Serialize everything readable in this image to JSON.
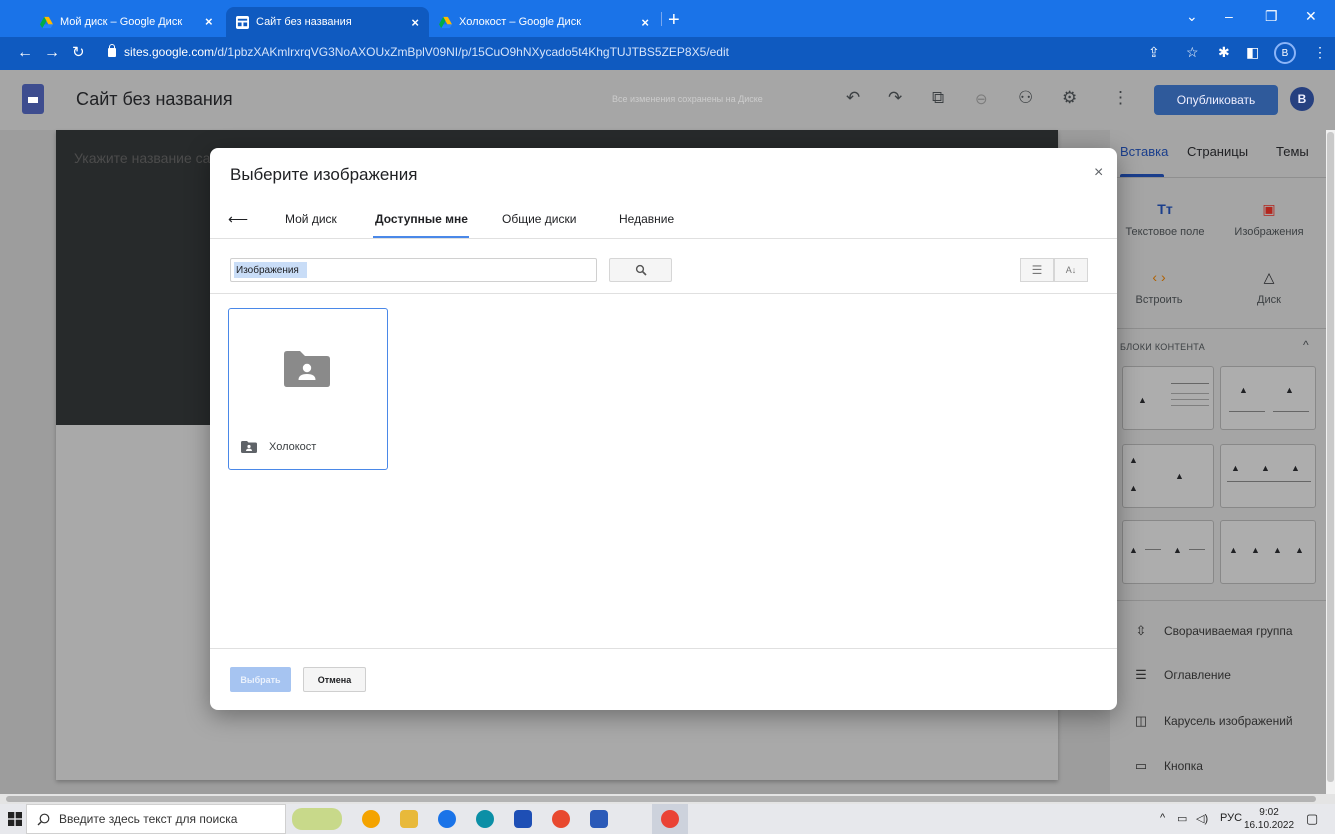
{
  "browser": {
    "tabs": [
      {
        "label": "Мой диск – Google Диск",
        "active": false
      },
      {
        "label": "Сайт без названия",
        "active": true
      },
      {
        "label": "Холокост – Google Диск",
        "active": false
      }
    ],
    "address_host": "sites.google.com",
    "address_path": "/d/1pbzXAKmlrxrqVG3NoAXOUxZmBplV09NI/p/15CuO9hNXycado5t4KhgTUJTBS5ZEP8X5/edit",
    "profile_initial": "В"
  },
  "sites_header": {
    "title": "Сайт без названия",
    "save_status": "Все изменения сохранены на Диске",
    "publish_label": "Опубликовать",
    "avatar_initial": "В"
  },
  "page_canvas": {
    "title_placeholder": "Укажите название сайта"
  },
  "dialog": {
    "title": "Выберите изображения",
    "tabs": [
      {
        "label": "Мой диск",
        "active": false
      },
      {
        "label": "Доступные мне",
        "active": true
      },
      {
        "label": "Общие диски",
        "active": false
      },
      {
        "label": "Недавние",
        "active": false
      }
    ],
    "search_value": "Изображения",
    "folders": [
      {
        "name": "Холокост"
      }
    ],
    "select_label": "Выбрать",
    "cancel_label": "Отмена",
    "accent_color": "#4a88e8"
  },
  "side_panel": {
    "tabs": [
      {
        "label": "Вставка",
        "active": true
      },
      {
        "label": "Страницы",
        "active": false
      },
      {
        "label": "Темы",
        "active": false
      }
    ],
    "insert_tiles": [
      {
        "label": "Текстовое поле",
        "icon": "text-box-icon"
      },
      {
        "label": "Изображения",
        "icon": "image-icon"
      },
      {
        "label": "Встроить",
        "icon": "embed-icon"
      },
      {
        "label": "Диск",
        "icon": "drive-icon"
      }
    ],
    "content_blocks_heading": "БЛОКИ КОНТЕНТА",
    "list_items": [
      {
        "label": "Сворачиваемая группа",
        "icon": "collapsible-group-icon"
      },
      {
        "label": "Оглавление",
        "icon": "table-of-contents-icon"
      },
      {
        "label": "Карусель изображений",
        "icon": "image-carousel-icon"
      },
      {
        "label": "Кнопка",
        "icon": "button-icon"
      }
    ]
  },
  "taskbar": {
    "search_placeholder": "Введите здесь текст для поиска",
    "language": "РУС",
    "time": "9:02",
    "date": "16.10.2022"
  }
}
